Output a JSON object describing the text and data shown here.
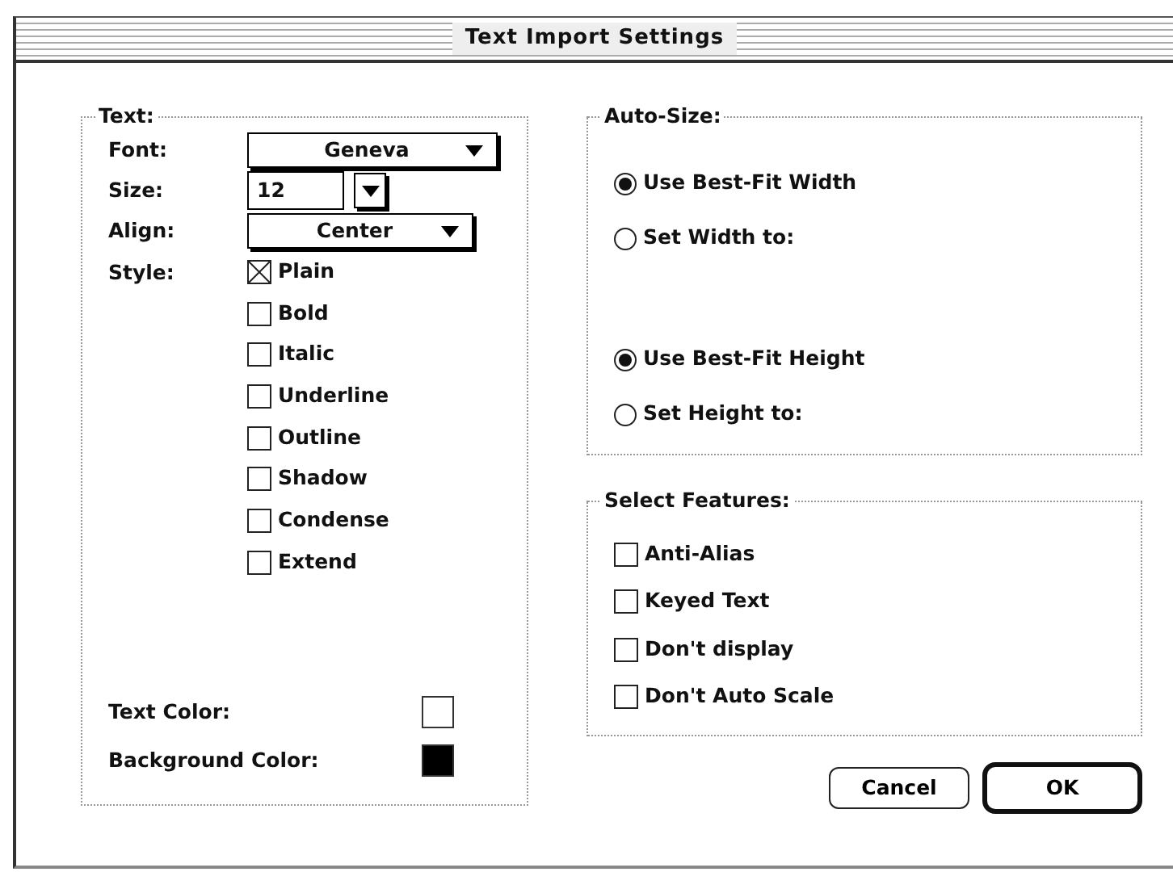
{
  "window": {
    "title": "Text Import Settings"
  },
  "text_group": {
    "title": "Text:",
    "font": {
      "label": "Font:",
      "value": "Geneva"
    },
    "size": {
      "label": "Size:",
      "value": "12"
    },
    "align": {
      "label": "Align:",
      "value": "Center"
    },
    "style": {
      "label": "Style:",
      "options": [
        {
          "label": "Plain",
          "checked": true
        },
        {
          "label": "Bold",
          "checked": false
        },
        {
          "label": "Italic",
          "checked": false
        },
        {
          "label": "Underline",
          "checked": false
        },
        {
          "label": "Outline",
          "checked": false
        },
        {
          "label": "Shadow",
          "checked": false
        },
        {
          "label": "Condense",
          "checked": false
        },
        {
          "label": "Extend",
          "checked": false
        }
      ]
    },
    "colors": [
      {
        "label": "Text Color:",
        "color": "#ffffff"
      },
      {
        "label": "Background Color:",
        "color": "#000000"
      }
    ]
  },
  "auto_size": {
    "title": "Auto-Size:",
    "groups": [
      [
        {
          "label": "Use Best-Fit Width",
          "selected": true
        },
        {
          "label": "Set Width to:",
          "selected": false
        }
      ],
      [
        {
          "label": "Use Best-Fit Height",
          "selected": true
        },
        {
          "label": "Set Height to:",
          "selected": false
        }
      ]
    ]
  },
  "features": {
    "title": "Select Features:",
    "options": [
      {
        "label": "Anti-Alias",
        "checked": false
      },
      {
        "label": "Keyed Text",
        "checked": false
      },
      {
        "label": "Don't display",
        "checked": false
      },
      {
        "label": "Don't Auto Scale",
        "checked": false
      }
    ]
  },
  "buttons": [
    {
      "label": "Cancel",
      "default": false
    },
    {
      "label": "OK",
      "default": true
    }
  ]
}
